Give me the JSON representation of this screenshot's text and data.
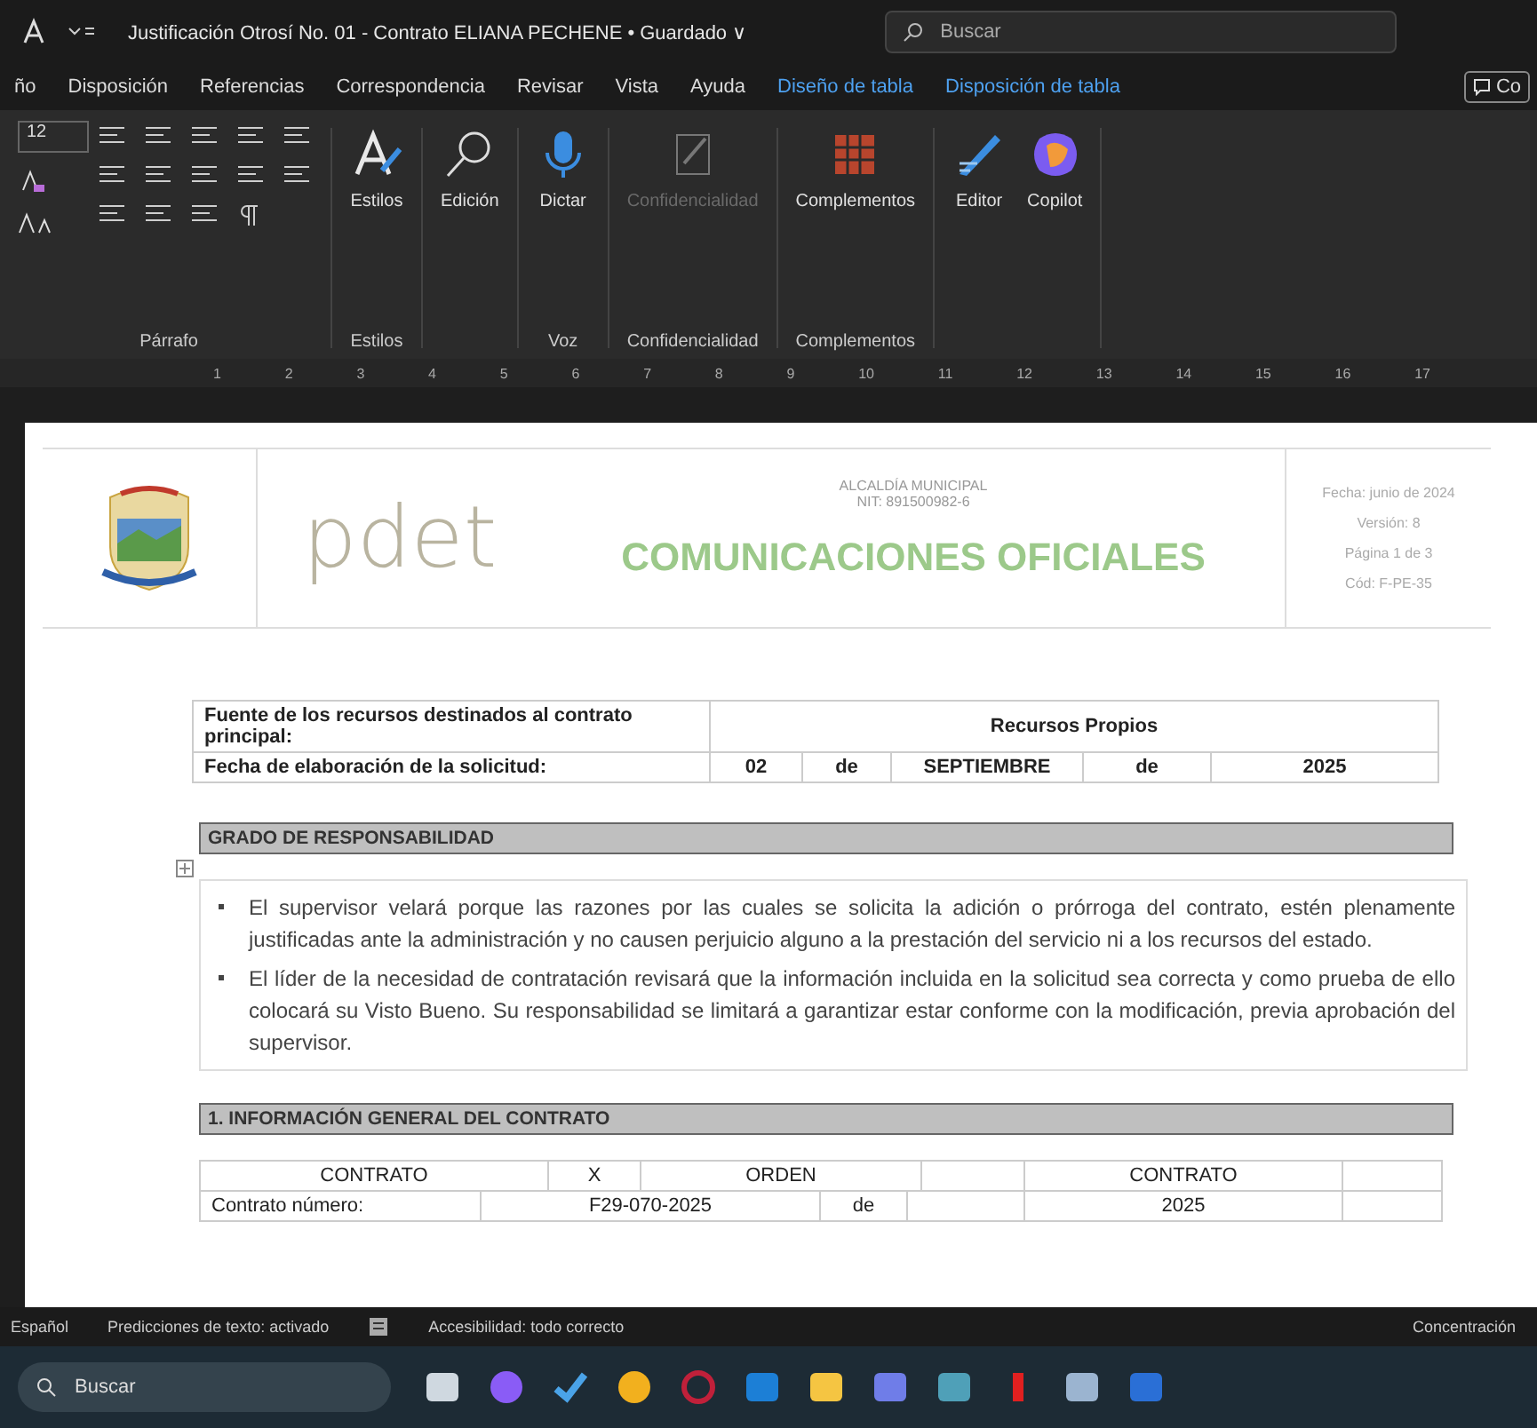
{
  "window": {
    "title": "Justificación Otrosí No. 01 - Contrato ELIANA PECHENE • Guardado ∨",
    "search_placeholder": "Buscar"
  },
  "tabs": [
    {
      "label": "ño",
      "contextual": false
    },
    {
      "label": "Disposición",
      "contextual": false
    },
    {
      "label": "Referencias",
      "contextual": false
    },
    {
      "label": "Correspondencia",
      "contextual": false
    },
    {
      "label": "Revisar",
      "contextual": false
    },
    {
      "label": "Vista",
      "contextual": false
    },
    {
      "label": "Ayuda",
      "contextual": false
    },
    {
      "label": "Diseño de tabla",
      "contextual": true
    },
    {
      "label": "Disposición de tabla",
      "contextual": true
    }
  ],
  "comments_button": "Co",
  "ribbon": {
    "font_size": "12",
    "groups": [
      {
        "kind": "paragraph",
        "label": "Párrafo"
      },
      {
        "kind": "styles",
        "label": "Estilos",
        "buttons": [
          {
            "label": "Estilos",
            "disabled": false
          }
        ]
      },
      {
        "kind": "editing",
        "buttons": [
          {
            "label": "Edición",
            "disabled": false
          }
        ]
      },
      {
        "kind": "voice",
        "label": "Voz",
        "buttons": [
          {
            "label": "Dictar",
            "disabled": false
          }
        ]
      },
      {
        "kind": "sensitivity",
        "label": "Confidencialidad",
        "buttons": [
          {
            "label": "Confidencialidad",
            "disabled": true
          }
        ]
      },
      {
        "kind": "addins",
        "label": "Complementos",
        "buttons": [
          {
            "label": "Complementos",
            "disabled": false
          }
        ]
      },
      {
        "kind": "ai",
        "buttons": [
          {
            "label": "Editor",
            "disabled": false
          },
          {
            "label": "Copilot",
            "disabled": false
          }
        ]
      }
    ]
  },
  "ruler": [
    "1",
    "2",
    "3",
    "4",
    "5",
    "6",
    "7",
    "8",
    "9",
    "10",
    "11",
    "12",
    "13",
    "14",
    "15",
    "16",
    "17"
  ],
  "header": {
    "entity": "ALCALDÍA MUNICIPAL",
    "nit": "NIT: 891500982-6",
    "title": "COMUNICACIONES OFICIALES",
    "logo_text": "pdet",
    "meta": [
      "Fecha: junio de 2024",
      "Versión: 8",
      "Página 1 de 3",
      "Cód: F-PE-35"
    ]
  },
  "resources": {
    "source_label": "Fuente de los recursos destinados al contrato principal:",
    "source_value": "Recursos Propios",
    "date_label": "Fecha de elaboración de la solicitud:",
    "date_parts": [
      "02",
      "de",
      "SEPTIEMBRE",
      "de",
      "2025"
    ]
  },
  "responsibility": {
    "heading": "GRADO DE RESPONSABILIDAD",
    "items": [
      "El supervisor velará porque las razones por las cuales se solicita la adición o prórroga del contrato, estén plenamente justificadas ante la administración y no causen perjuicio alguno a la prestación del servicio ni a los recursos del estado.",
      "El líder de la necesidad de contratación revisará que la información incluida en la solicitud sea correcta y como prueba de ello colocará su Visto Bueno. Su responsabilidad se limitará a garantizar estar conforme con la modificación, previa aprobación del supervisor."
    ]
  },
  "section1": {
    "heading": "1. INFORMACIÓN GENERAL DEL CONTRATO",
    "rows": [
      {
        "cells": [
          {
            "text": "CONTRATO"
          },
          {
            "text": "X"
          },
          {
            "text": "ORDEN"
          },
          {},
          {
            "text": "CONTRATO"
          },
          {}
        ]
      },
      {
        "cells": [
          {
            "text": "Contrato número:"
          },
          {
            "text": "F29-070-2025"
          },
          {
            "text": "de"
          },
          {},
          {
            "text": "2025"
          },
          {}
        ]
      }
    ]
  },
  "status_bar": [
    "Español",
    "Predicciones de texto: activado",
    "Accesibilidad: todo correcto",
    "Concentración"
  ],
  "taskbar": {
    "search_placeholder": "Buscar"
  }
}
